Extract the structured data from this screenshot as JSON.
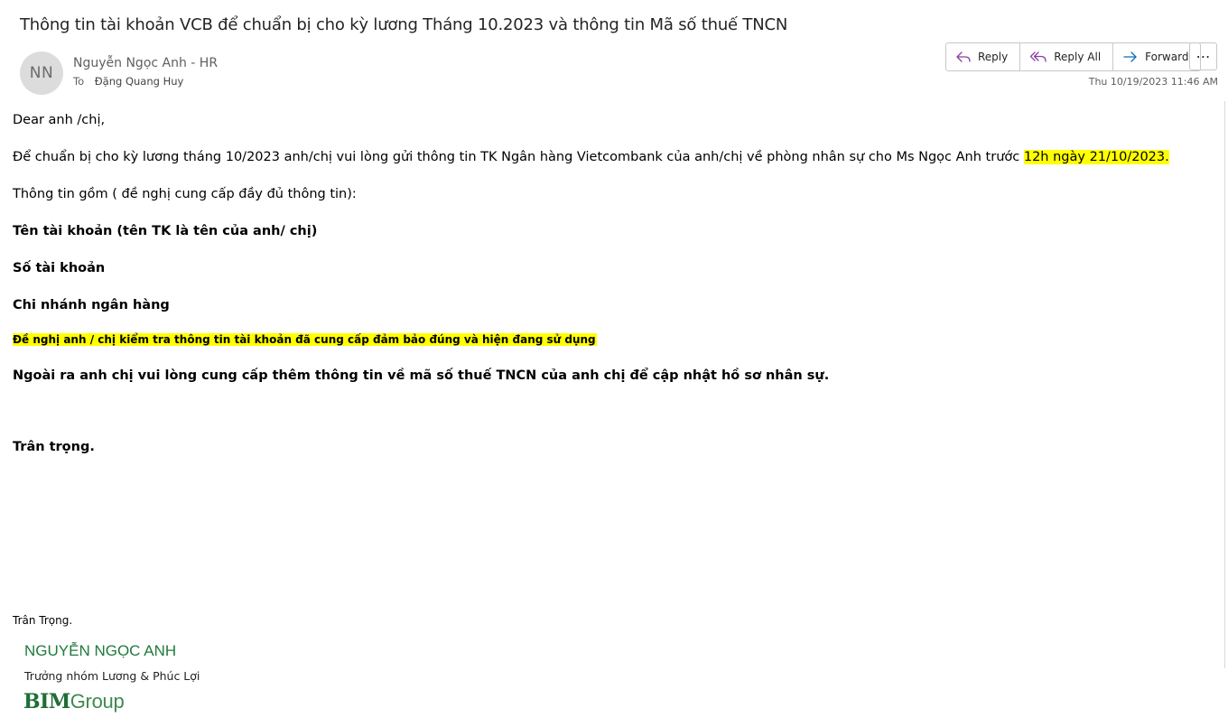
{
  "email": {
    "subject": "Thông tin tài khoản VCB để chuẩn bị cho kỳ lương Tháng 10.2023 và thông tin Mã số thuế TNCN",
    "sender": {
      "initials": "NN",
      "name": "Nguyễn Ngọc Anh - HR"
    },
    "to_label": "To",
    "to_name": "Đặng Quang Huy",
    "date": "Thu 10/19/2023 11:46 AM"
  },
  "actions": {
    "reply": "Reply",
    "reply_all": "Reply All",
    "forward": "Forward",
    "more": "⋯"
  },
  "body": {
    "greeting": "Dear anh /chị,",
    "line1_prefix": "Để chuẩn bị cho kỳ lương tháng 10/2023 anh/chị vui lòng gửi thông tin TK Ngân hàng Vietcombank của anh/chị về phòng nhân sự cho Ms Ngọc Anh trước ",
    "line1_highlight": "12h ngày 21/10/2023.",
    "info_intro": "Thông tin gồm ( đề nghị cung cấp đầy đủ thông tin):",
    "field1": "Tên tài khoản (tên TK là tên của anh/ chị)",
    "field2": "Số tài khoản",
    "field3": "Chi nhánh ngân hàng",
    "check_note": "Đề nghị anh / chị kiểm tra thông tin tài khoản đã cung cấp đảm bảo đúng và hiện đang sử dụng",
    "tax_note": "Ngoài ra anh chị vui lòng cung cấp thêm thông tin về mã số thuế TNCN của anh chị để cập nhật hồ sơ nhân sự.",
    "closing": "Trân trọng."
  },
  "signature": {
    "closing": "Trân Trọng.",
    "name": "NGUYỄN NGỌC ANH",
    "role": "Trưởng nhóm Lương & Phúc Lợi",
    "logo_part1": "BIM",
    "logo_part2": "Group"
  },
  "colors": {
    "highlight": "#ffff00",
    "signature_green": "#1f7a3e",
    "reply_icon": "#8a3fa0",
    "forward_icon": "#0f6cbd"
  },
  "icons": {
    "reply": "reply-arrow-icon",
    "reply_all": "reply-all-arrow-icon",
    "forward": "forward-arrow-icon",
    "more": "more-dots-icon"
  }
}
